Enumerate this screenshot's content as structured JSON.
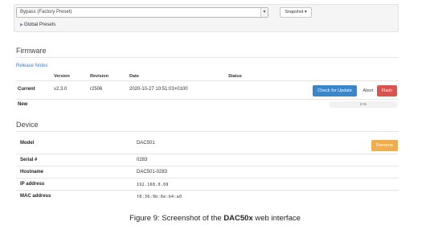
{
  "presets": {
    "selected": "Bypass (Factory Preset)",
    "snapshot_label": "Snapshot",
    "global_presets_label": "Global Presets"
  },
  "firmware": {
    "title": "Firmware",
    "release_notes": "Release Notes",
    "headers": {
      "version": "Version",
      "revision": "Revision",
      "date": "Date",
      "status": "Status"
    },
    "current": {
      "label": "Current",
      "version": "v2.3.0",
      "revision": "r2506",
      "date": "2020-10-27 10:51:03+0100"
    },
    "new": {
      "label": "New",
      "progress_text": "0 %",
      "progress": 0
    },
    "check_update_label": "Check for Update",
    "abort_label": "Abort",
    "flash_label": "Flash"
  },
  "device": {
    "title": "Device",
    "model_label": "Model",
    "model": "DAC501",
    "rename_label": "Rename",
    "serial_label": "Serial #",
    "serial": "0283",
    "hostname_label": "Hostname",
    "hostname": "DAC501-0283",
    "ip_label": "IP address",
    "ip": "192.168.0.69",
    "mac_label": "MAC address",
    "mac": "f8:36:9b:0e:b4:a0"
  },
  "caption": {
    "prefix": "Figure 9:  Screenshot of the ",
    "product": "DAC50x",
    "suffix": " web interface"
  },
  "colors": {
    "primary": "#3b86c9",
    "danger": "#d9534f",
    "warning": "#efad4e",
    "link": "#3a7cc7"
  }
}
